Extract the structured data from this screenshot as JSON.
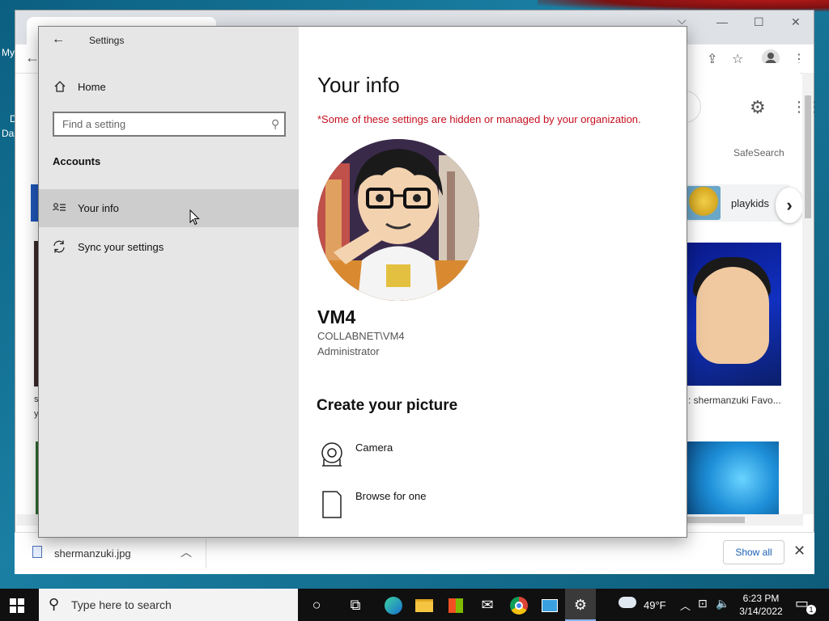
{
  "desktop": {
    "labels": [
      "My",
      "D",
      "Da"
    ]
  },
  "chrome": {
    "safesearch": "SafeSearch",
    "chip_label": "playkids",
    "thumb_caption": ": shermanzuki Favo...",
    "left_caption_1": "s",
    "left_caption_2": "y"
  },
  "download_bar": {
    "file_name": "shermanzuki.jpg",
    "show_all": "Show all"
  },
  "settings": {
    "app_title": "Settings",
    "home_label": "Home",
    "search_placeholder": "Find a setting",
    "section_title": "Accounts",
    "nav_items": [
      {
        "label": "Your info",
        "active": true
      },
      {
        "label": "Sync your settings",
        "active": false
      }
    ],
    "page_title": "Your info",
    "org_note": "*Some of these settings are hidden or managed by your organization.",
    "user": {
      "name": "VM4",
      "account": "COLLABNET\\VM4",
      "role": "Administrator"
    },
    "create_picture_title": "Create your picture",
    "options": [
      {
        "label": "Camera",
        "icon": "camera-icon"
      },
      {
        "label": "Browse for one",
        "icon": "file-icon"
      }
    ]
  },
  "taskbar": {
    "search_placeholder": "Type here to search",
    "weather": "49°F",
    "time": "6:23 PM",
    "date": "3/14/2022",
    "notifications": "1"
  }
}
